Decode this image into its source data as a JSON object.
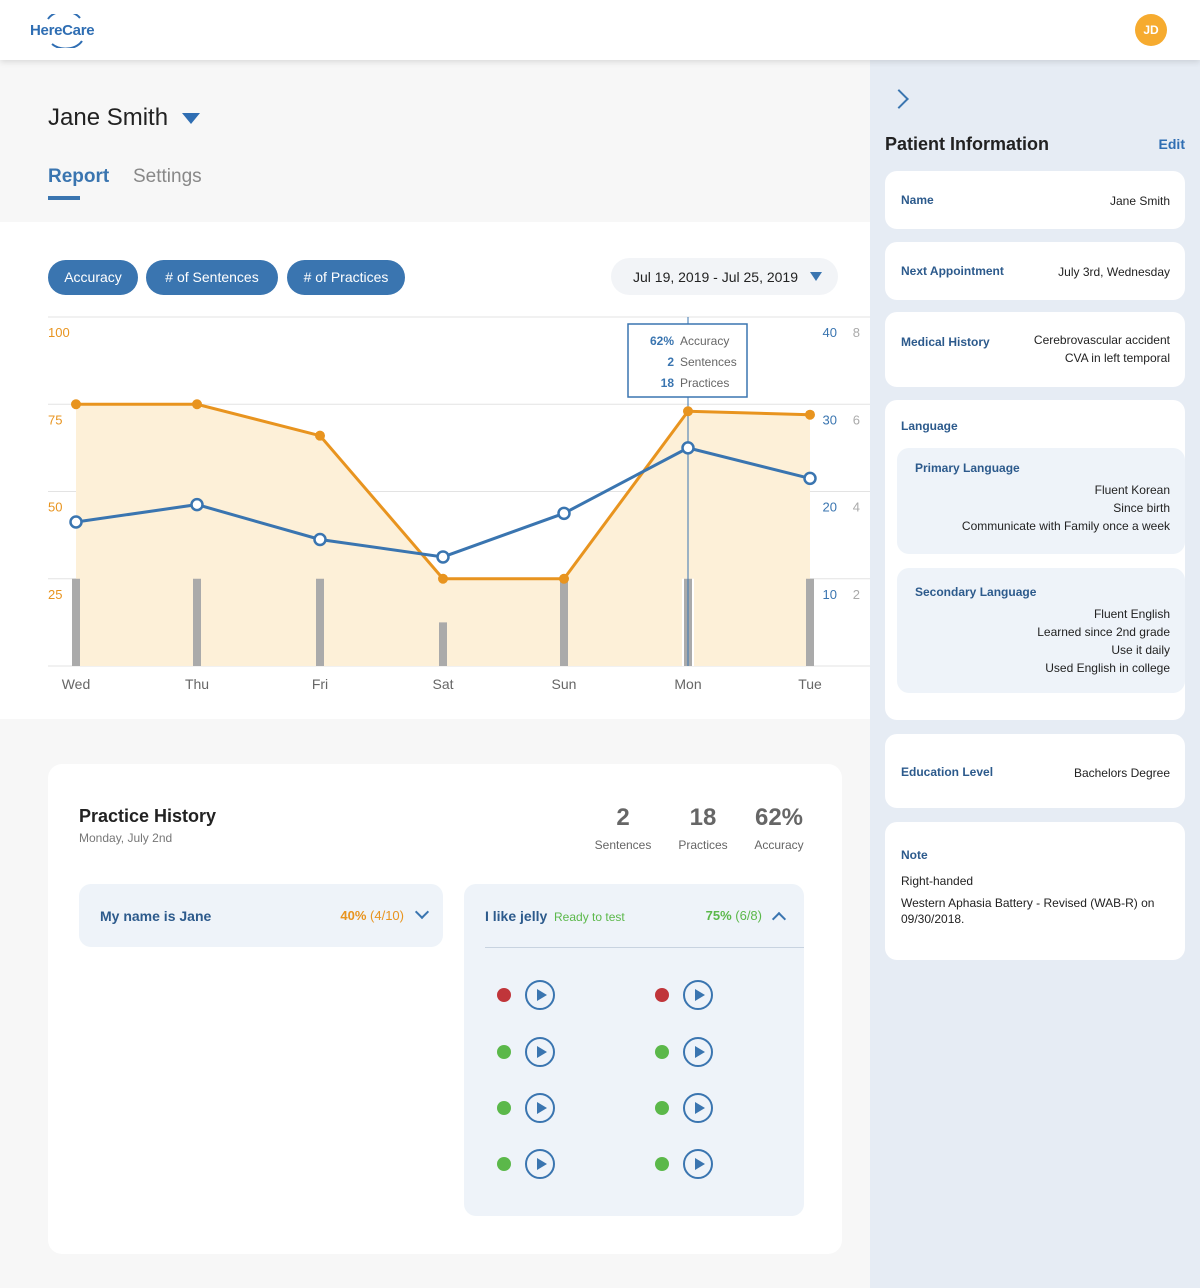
{
  "app": {
    "logo": "HereCare",
    "avatar_initials": "JD"
  },
  "patient": {
    "name": "Jane Smith"
  },
  "tabs": [
    "Report",
    "Settings"
  ],
  "filters": [
    "Accuracy",
    "# of Sentences",
    "# of Practices"
  ],
  "date_range": "Jul 19, 2019 - Jul 25, 2019",
  "tooltip": {
    "accuracy_value": "62%",
    "accuracy_label": "Accuracy",
    "sentences_value": "2",
    "sentences_label": "Sentences",
    "practices_value": "18",
    "practices_label": "Practices"
  },
  "chart_data": {
    "type": "line",
    "categories": [
      "Wed",
      "Thu",
      "Fri",
      "Sat",
      "Sun",
      "Mon",
      "Tue"
    ],
    "series": [
      {
        "name": "Accuracy",
        "axis": "left",
        "color": "#e8941f",
        "values": [
          75,
          75,
          66,
          25,
          25,
          73,
          72
        ]
      },
      {
        "name": "# of Sentences",
        "axis": "right-1",
        "color": "#3a75b0",
        "values": [
          16.5,
          18.5,
          14.5,
          12.5,
          17.5,
          25,
          21.5
        ]
      },
      {
        "name": "# of Practices",
        "axis": "right-2",
        "type": "bar",
        "color": "#aaaaaa",
        "values": [
          2,
          2,
          2,
          1,
          2,
          2,
          2
        ]
      }
    ],
    "left_axis": {
      "ticks": [
        "100",
        "75",
        "50",
        "25"
      ],
      "range": [
        0,
        100
      ]
    },
    "right_axis_1": {
      "ticks": [
        "40",
        "30",
        "20",
        "10"
      ],
      "range": [
        0,
        40
      ]
    },
    "right_axis_2": {
      "ticks": [
        "8",
        "6",
        "4",
        "2"
      ],
      "range": [
        0,
        8
      ]
    },
    "highlight_index": 5,
    "grid": true
  },
  "history": {
    "title": "Practice History",
    "date": "Monday, July 2nd",
    "stats": [
      {
        "value": "2",
        "label": "Sentences"
      },
      {
        "value": "18",
        "label": "Practices"
      },
      {
        "value": "62%",
        "label": "Accuracy"
      }
    ],
    "sentences": [
      {
        "title": "My name is Jane",
        "percent": "40%",
        "fraction": "(4/10)"
      },
      {
        "title": "I like jelly",
        "status": "Ready to test",
        "percent": "75%",
        "fraction": "(6/8)",
        "recordings": [
          "red",
          "green",
          "green",
          "green",
          "red",
          "green",
          "green",
          "green"
        ]
      }
    ]
  },
  "sidebar": {
    "title": "Patient Information",
    "edit": "Edit",
    "name_label": "Name",
    "name_value": "Jane Smith",
    "appt_label": "Next Appointment",
    "appt_value": "July 3rd, Wednesday",
    "history_label": "Medical History",
    "history_lines": [
      "Cerebrovascular accident",
      "CVA in left temporal"
    ],
    "language_label": "Language",
    "primary_label": "Primary Language",
    "primary_lines": [
      "Fluent Korean",
      "Since birth",
      "Communicate with Family once a week"
    ],
    "secondary_label": "Secondary Language",
    "secondary_lines": [
      "Fluent English",
      "Learned since 2nd grade",
      "Use it daily",
      "Used English in college"
    ],
    "education_label": "Education Level",
    "education_value": "Bachelors Degree",
    "note_label": "Note",
    "note_lines": [
      "Right-handed",
      "Western Aphasia Battery - Revised (WAB-R) on 09/30/2018."
    ]
  }
}
